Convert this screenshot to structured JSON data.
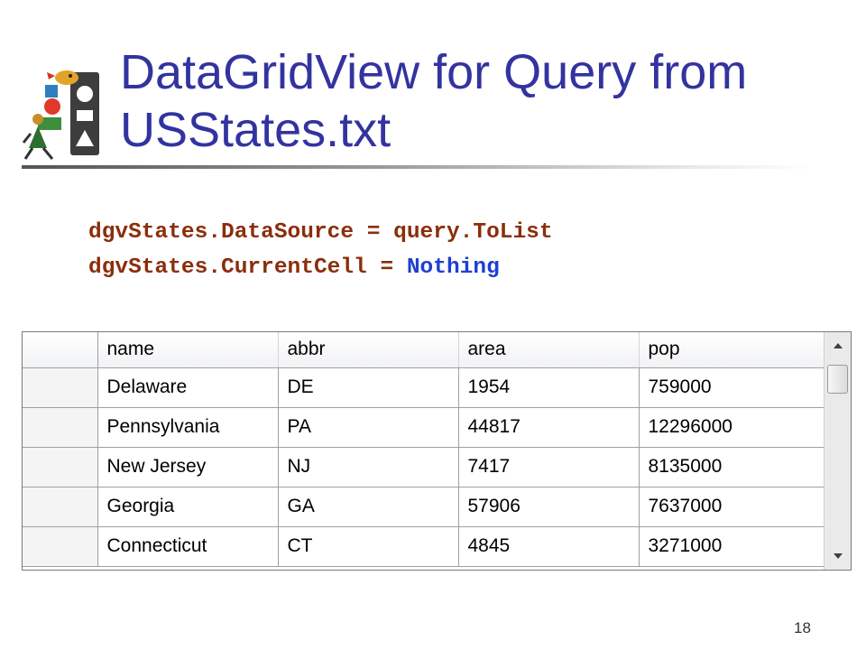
{
  "slide": {
    "title_line1": "DataGridView for Query from",
    "title_line2": "USStates.txt",
    "page_number": "18"
  },
  "code": {
    "line1": "dgvStates.DataSource = query.ToList",
    "line2_prefix": "dgvStates.CurrentCell = ",
    "line2_keyword": "Nothing"
  },
  "colors": {
    "title": "#3333a0",
    "code_text": "#8b2e0b",
    "code_keyword": "#1f3fd0"
  },
  "grid": {
    "columns": [
      "name",
      "abbr",
      "area",
      "pop"
    ],
    "rows": [
      [
        "Delaware",
        "DE",
        "1954",
        "759000"
      ],
      [
        "Pennsylvania",
        "PA",
        "44817",
        "12296000"
      ],
      [
        "New Jersey",
        "NJ",
        "7417",
        "8135000"
      ],
      [
        "Georgia",
        "GA",
        "57906",
        "7637000"
      ],
      [
        "Connecticut",
        "CT",
        "4845",
        "3271000"
      ]
    ]
  }
}
